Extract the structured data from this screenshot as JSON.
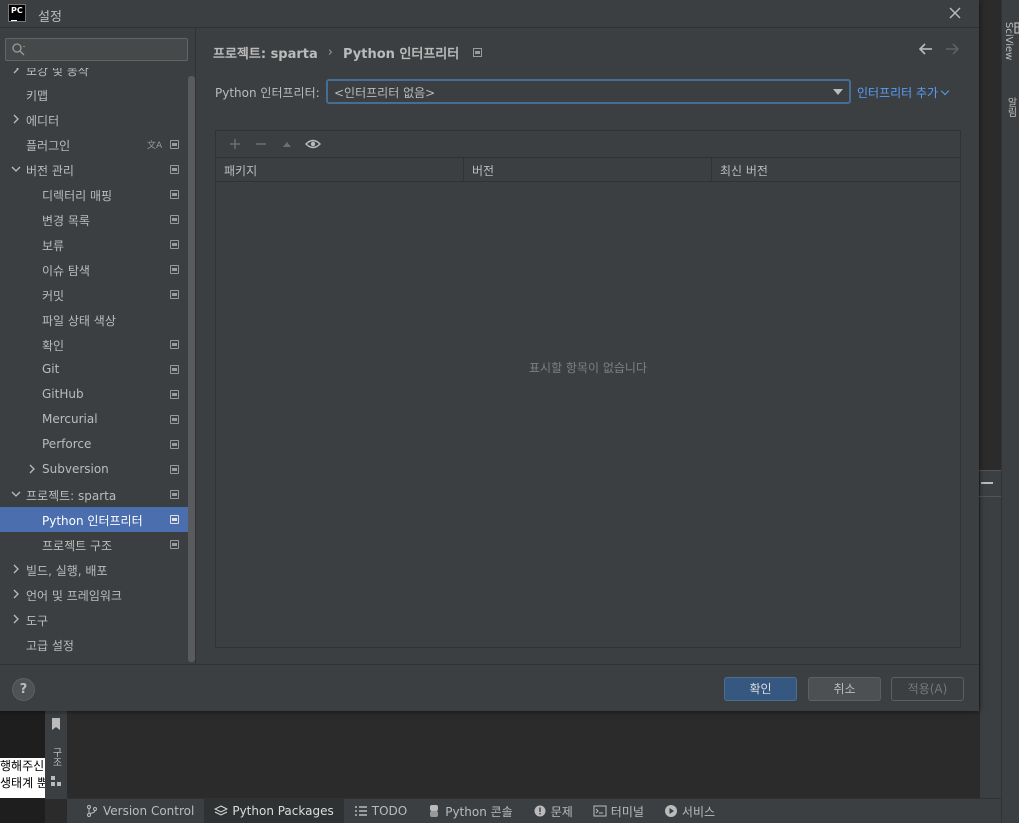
{
  "dialog": {
    "title": "설정",
    "logo_text": "PC"
  },
  "search": {
    "placeholder": "",
    "value": ""
  },
  "tree": [
    {
      "label": "보강 및 동작",
      "level": 0,
      "expand": "collapsed",
      "proj": false
    },
    {
      "label": "키맵",
      "level": 0,
      "expand": "none",
      "proj": false
    },
    {
      "label": "에디터",
      "level": 0,
      "expand": "collapsed",
      "proj": false
    },
    {
      "label": "플러그인",
      "level": 0,
      "expand": "none",
      "proj": true,
      "translate": true
    },
    {
      "label": "버전 관리",
      "level": 0,
      "expand": "expanded",
      "proj": true
    },
    {
      "label": "디렉터리 매핑",
      "level": 1,
      "expand": "none",
      "proj": true
    },
    {
      "label": "변경 목록",
      "level": 1,
      "expand": "none",
      "proj": true
    },
    {
      "label": "보류",
      "level": 1,
      "expand": "none",
      "proj": true
    },
    {
      "label": "이슈 탐색",
      "level": 1,
      "expand": "none",
      "proj": true
    },
    {
      "label": "커밋",
      "level": 1,
      "expand": "none",
      "proj": true
    },
    {
      "label": "파일 상태 색상",
      "level": 1,
      "expand": "none",
      "proj": false
    },
    {
      "label": "확인",
      "level": 1,
      "expand": "none",
      "proj": true
    },
    {
      "label": "Git",
      "level": 1,
      "expand": "none",
      "proj": true
    },
    {
      "label": "GitHub",
      "level": 1,
      "expand": "none",
      "proj": true
    },
    {
      "label": "Mercurial",
      "level": 1,
      "expand": "none",
      "proj": true
    },
    {
      "label": "Perforce",
      "level": 1,
      "expand": "none",
      "proj": true
    },
    {
      "label": "Subversion",
      "level": 1,
      "expand": "collapsed",
      "proj": true
    },
    {
      "label": "프로젝트: sparta",
      "level": 0,
      "expand": "expanded",
      "proj": true
    },
    {
      "label": "Python 인터프리터",
      "level": 1,
      "expand": "none",
      "proj": true,
      "selected": true
    },
    {
      "label": "프로젝트 구조",
      "level": 1,
      "expand": "none",
      "proj": true
    },
    {
      "label": "빌드, 실행, 배포",
      "level": 0,
      "expand": "collapsed",
      "proj": false
    },
    {
      "label": "언어 및 프레임워크",
      "level": 0,
      "expand": "collapsed",
      "proj": false
    },
    {
      "label": "도구",
      "level": 0,
      "expand": "collapsed",
      "proj": false
    },
    {
      "label": "고급 설정",
      "level": 0,
      "expand": "none",
      "proj": false
    }
  ],
  "breadcrumb": {
    "parent": "프로젝트: sparta",
    "separator": "›",
    "current": "Python 인터프리터"
  },
  "interpreter": {
    "label": "Python 인터프리터:",
    "selected": "<인터프리터 없음>",
    "add_link": "인터프리터 추가"
  },
  "packages": {
    "columns": [
      "패키지",
      "버전",
      "최신 버전"
    ],
    "empty_text": "표시할 항목이 없습니다"
  },
  "footer": {
    "help": "?",
    "ok": "확인",
    "cancel": "취소",
    "apply": "적용(A)"
  },
  "ide": {
    "side_tools": [
      "SciView",
      "알림"
    ],
    "background_text": [
      "행해주신",
      "생태계 뿐"
    ],
    "left_strip_label": "구조",
    "bottom_tabs": [
      {
        "label": "Version Control",
        "icon": "branch-icon"
      },
      {
        "label": "Python Packages",
        "icon": "layers-icon",
        "active": true
      },
      {
        "label": "TODO",
        "icon": "list-icon"
      },
      {
        "label": "Python 콘솔",
        "icon": "python-icon"
      },
      {
        "label": "문제",
        "icon": "warning-icon"
      },
      {
        "label": "터미널",
        "icon": "terminal-icon"
      },
      {
        "label": "서비스",
        "icon": "play-icon"
      }
    ]
  },
  "colors": {
    "selection": "#4b6eaf",
    "link": "#589df6",
    "ok_button": "#365880",
    "focus_border": "#466d94"
  }
}
